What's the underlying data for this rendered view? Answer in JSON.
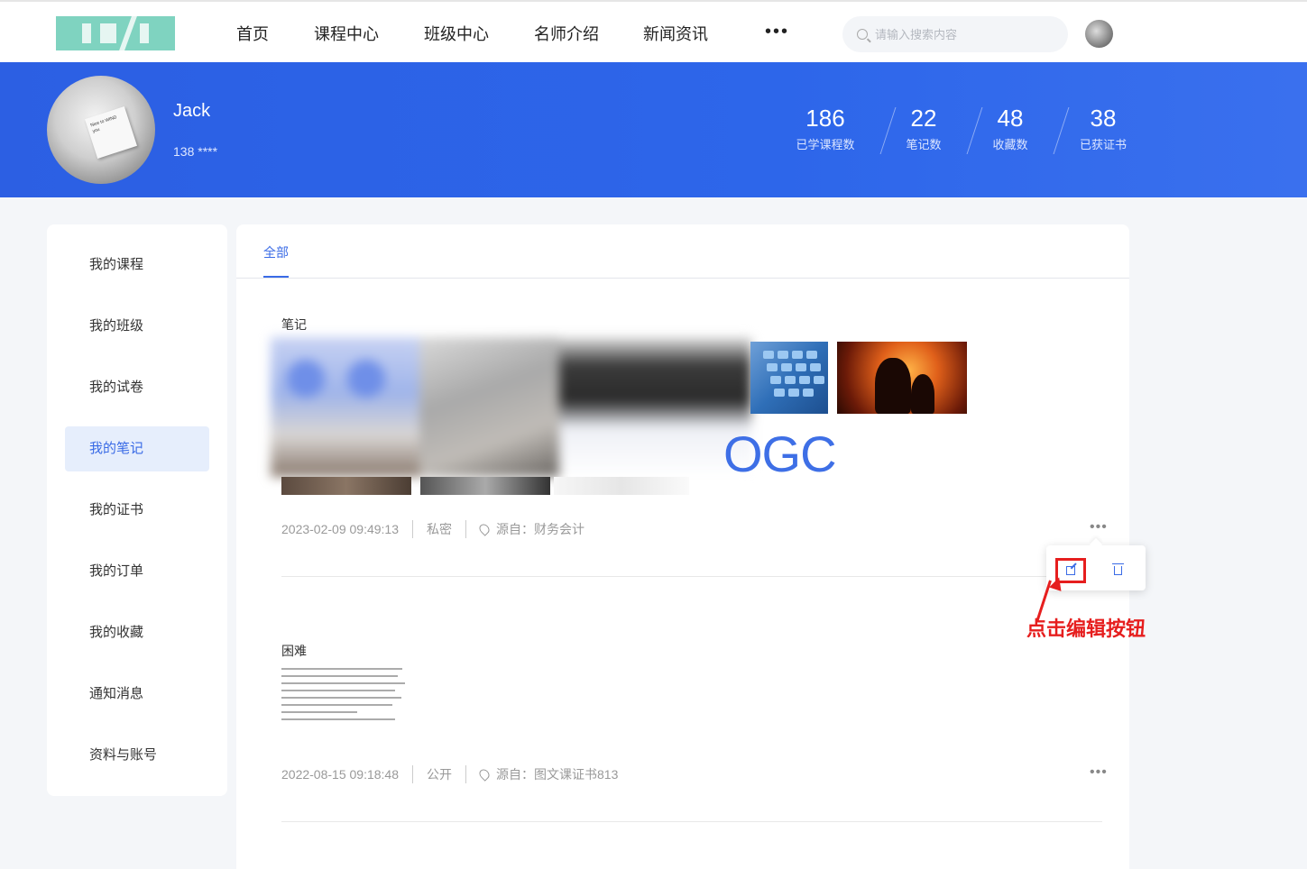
{
  "nav": {
    "items": [
      "首页",
      "课程中心",
      "班级中心",
      "名师介绍",
      "新闻资讯"
    ],
    "more": "•••",
    "search_placeholder": "请输入搜索内容"
  },
  "profile": {
    "name": "Jack",
    "phone": "138 ****",
    "avatar_card_text": "Nice to WIND you"
  },
  "stats": [
    {
      "value": "186",
      "label": "已学课程数"
    },
    {
      "value": "22",
      "label": "笔记数"
    },
    {
      "value": "48",
      "label": "收藏数"
    },
    {
      "value": "38",
      "label": "已获证书"
    }
  ],
  "sidebar": {
    "items": [
      {
        "label": "我的课程",
        "active": false
      },
      {
        "label": "我的班级",
        "active": false
      },
      {
        "label": "我的试卷",
        "active": false
      },
      {
        "label": "我的笔记",
        "active": true
      },
      {
        "label": "我的证书",
        "active": false
      },
      {
        "label": "我的订单",
        "active": false
      },
      {
        "label": "我的收藏",
        "active": false
      },
      {
        "label": "通知消息",
        "active": false
      },
      {
        "label": "资料与账号",
        "active": false
      }
    ]
  },
  "tabs": {
    "active": "全部"
  },
  "notes": [
    {
      "title": "笔记",
      "image_text": "OGC",
      "date": "2023-02-09 09:49:13",
      "visibility": "私密",
      "source": "源自：财务会计",
      "more": "•••"
    },
    {
      "title": "困难",
      "date": "2022-08-15 09:18:48",
      "visibility": "公开",
      "source": "源自：图文课证书813",
      "more": "•••"
    }
  ],
  "annotation": "点击编辑按钮",
  "colors": {
    "accent": "#3a6be6",
    "banner": "#2c5fe3",
    "highlight": "#e61e1e"
  }
}
